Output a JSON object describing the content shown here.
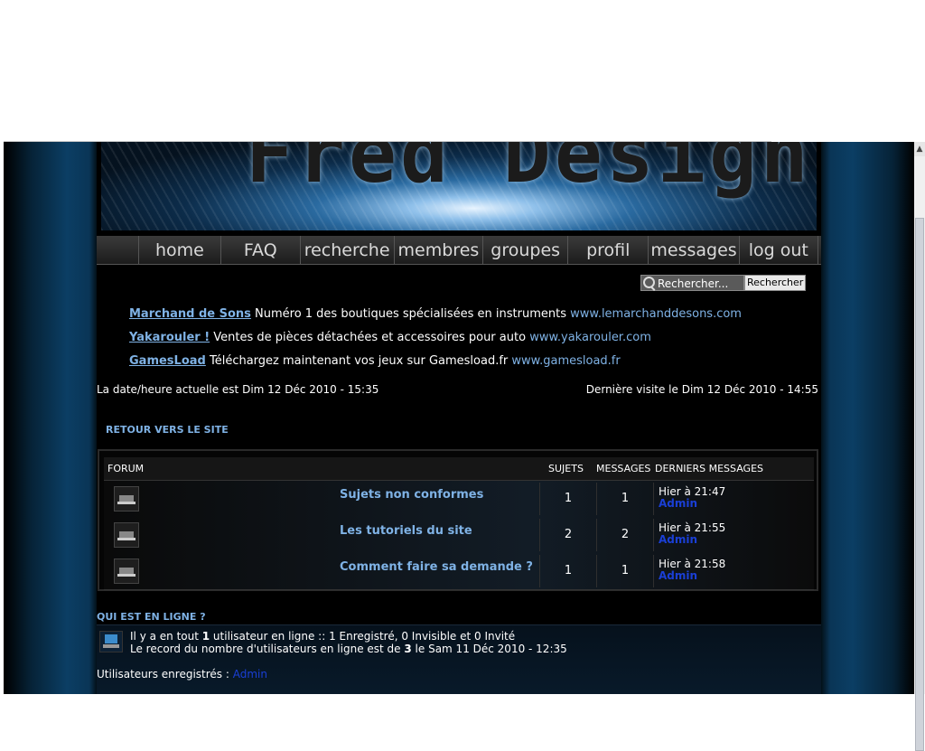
{
  "banner": {
    "logo_text": "Fred Design"
  },
  "nav": [
    "home",
    "FAQ",
    "recherche",
    "membres",
    "groupes",
    "profil",
    "messages",
    "log out"
  ],
  "search": {
    "placeholder": "Rechercher...",
    "button": "Rechercher"
  },
  "ads": [
    {
      "name": "Marchand de Sons",
      "text": " Numéro 1 des boutiques spécialisées en instruments ",
      "url": "www.lemarchanddesons.com"
    },
    {
      "name": "Yakarouler !",
      "text": " Ventes de pièces détachées et accessoires pour auto ",
      "url": "www.yakarouler.com"
    },
    {
      "name": "GamesLoad",
      "text": " Téléchargez maintenant vos jeux sur Gamesload.fr ",
      "url": "www.gamesload.fr"
    }
  ],
  "dates": {
    "current": "La date/heure actuelle est Dim 12 Déc 2010 - 15:35",
    "last_visit": "Dernière visite le Dim 12 Déc 2010 - 14:55"
  },
  "back_link": "RETOUR VERS LE SITE",
  "forum": {
    "headers": {
      "forum": "FORUM",
      "topics": "SUJETS",
      "messages": "MESSAGES",
      "last": "DERNIERS MESSAGES"
    },
    "rows": [
      {
        "title": "Sujets non conformes",
        "topics": "1",
        "messages": "1",
        "last_time": "Hier à 21:47",
        "last_user": "Admin"
      },
      {
        "title": "Les tutoriels du site",
        "topics": "2",
        "messages": "2",
        "last_time": "Hier à 21:55",
        "last_user": "Admin"
      },
      {
        "title": "Comment faire sa demande ?",
        "topics": "1",
        "messages": "1",
        "last_time": "Hier à 21:58",
        "last_user": "Admin"
      }
    ]
  },
  "who": {
    "title": "QUI EST EN LIGNE ?",
    "line1_a": "Il y a en tout ",
    "line1_count": "1",
    "line1_b": " utilisateur en ligne :: 1 Enregistré, 0 Invisible et 0 Invité",
    "line2_a": "Le record du nombre d'utilisateurs en ligne est de ",
    "line2_count": "3",
    "line2_b": " le Sam 11 Déc 2010 - 12:35",
    "registered_label": "Utilisateurs enregistrés : ",
    "registered_user": "Admin"
  },
  "colors": {
    "link": "#7fb2e5",
    "user": "#1a3fd6",
    "background": "#000000"
  }
}
